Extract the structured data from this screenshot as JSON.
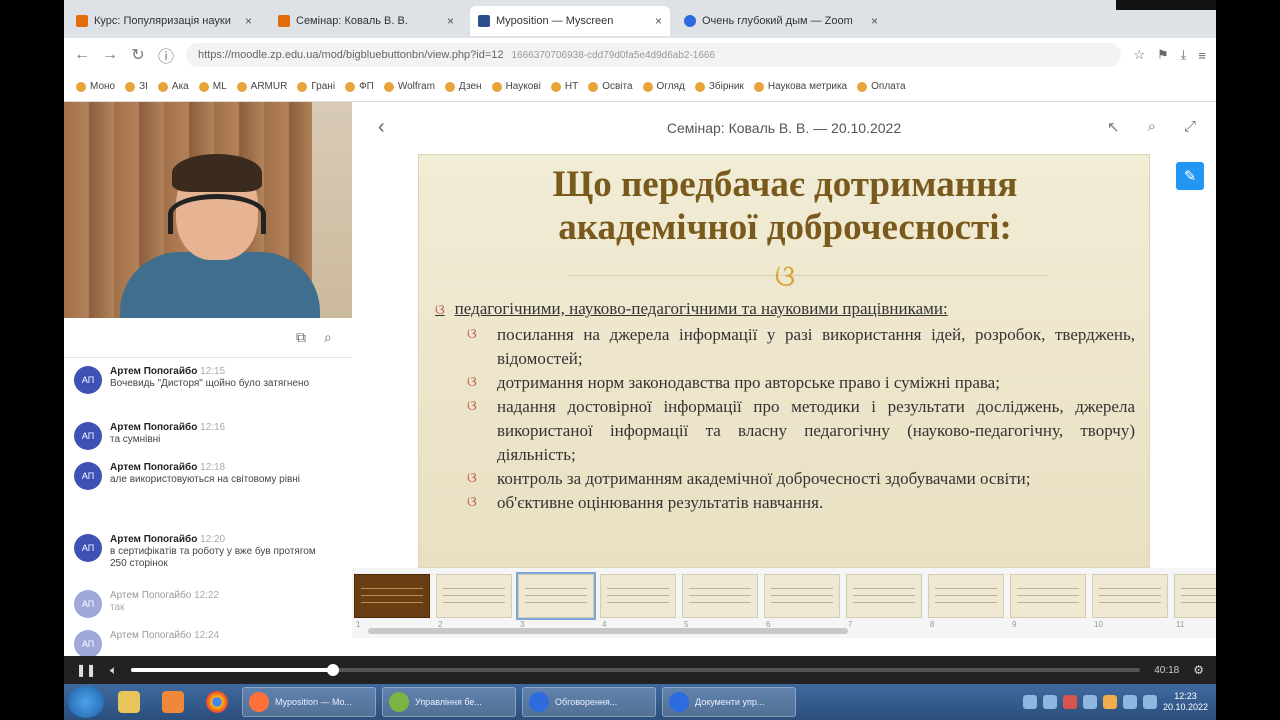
{
  "browser": {
    "tabs": [
      {
        "label": "Курс: Популяризація науки"
      },
      {
        "label": "Семінар: Коваль В. В."
      },
      {
        "label": "Myposition — Myscreen"
      },
      {
        "label": "Очень глубокий дым — Zoom"
      }
    ],
    "url": "https://moodle.zp.edu.ua/mod/bigbluebuttonbn/view.php?id=12",
    "url_tail": "1666370706938-cdd79d0fa5e4d9d6ab2-1666",
    "bookmarks": [
      "Моно",
      "ЗІ",
      "Ака",
      "ML",
      "ARMUR",
      "Грані",
      "ФП",
      "Wolfram",
      "Дзен",
      "Наукові",
      "НТ",
      "Освіта",
      "Огляд",
      "Збірник",
      "Наукова метрика",
      "Оплата"
    ]
  },
  "presentation": {
    "header": "Семінар: Коваль В. В. — 20.10.2022",
    "slide_title_line1": "Що передбачає дотримання",
    "slide_title_line2": "академічної доброчесності:",
    "flourish": "ଓ",
    "lead": "педагогічними, науково-педагогічними та науковими працівниками:",
    "items": [
      "посилання на джерела інформації у разі використання ідей, розробок, тверджень, відомостей;",
      "дотримання норм законодавства про авторське право і суміжні права;",
      "надання достовірної інформації про методики і результати досліджень, джерела використаної інформації та власну педагогічну (науково-педагогічну, творчу) діяльність;",
      "контроль за дотриманням академічної доброчесності здобувачами освіти;",
      "об'єктивне оцінювання результатів навчання."
    ],
    "thumb_numbers": [
      "1",
      "2",
      "3",
      "4",
      "5",
      "6",
      "7",
      "8",
      "9",
      "10",
      "11"
    ],
    "current_slide": 3
  },
  "chat": {
    "messages": [
      {
        "initials": "АП",
        "name": "Артем Попогайбо",
        "time": "12:15",
        "text": "Вочевидь \"Дисторя\" щойно було затягнено",
        "faded": false
      },
      {
        "initials": "АП",
        "name": "Артем Попогайбо",
        "time": "12:16",
        "text": "та сумнівні",
        "faded": false
      },
      {
        "initials": "АП",
        "name": "Артем Попогайбо",
        "time": "12:18",
        "text": "але використовуються на світовому рівні",
        "faded": false
      },
      {
        "initials": "АП",
        "name": "Артем Попогайбо",
        "time": "12:20",
        "text": "в сертифікатів та роботу у вже був протягом 250 сторінок",
        "faded": false
      },
      {
        "initials": "АП",
        "name": "Артем Попогайбо",
        "time": "12:22",
        "text": "так",
        "faded": true
      },
      {
        "initials": "АП",
        "name": "Артем Попогайбо",
        "time": "12:24",
        "text": "",
        "faded": true
      }
    ]
  },
  "video": {
    "progress": 0.2,
    "time": "40:18"
  },
  "taskbar": {
    "tasks": [
      {
        "label": "Myposition — Mo...",
        "color": "#ff7139"
      },
      {
        "label": "Управління бе...",
        "color": "#7cb342"
      },
      {
        "label": "Обговорення...",
        "color": "#2d6cdf"
      },
      {
        "label": "Документи упр...",
        "color": "#2d6cdf"
      }
    ],
    "clock_time": "12:23",
    "clock_date": "20.10.2022"
  }
}
